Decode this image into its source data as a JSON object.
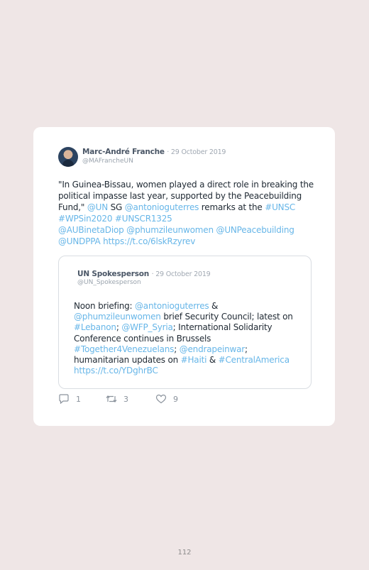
{
  "tweet": {
    "author_name": "Marc-André Franche",
    "date": "· 29 October 2019",
    "handle": "@MAFrancheUN",
    "t1": "\"In Guinea-Bissau, women played a direct role in breaking the political impasse last year, supported by the Peacebuilding Fund,\" ",
    "l_un": "@UN",
    "t2": " SG ",
    "l_ag": "@antonioguterres",
    "t3": " remarks at the ",
    "l_unsc": "#UNSC",
    "l_wps": "#WPSin2020",
    "l_unscr": "#UNSCR1325",
    "l_aub": "@AUBinetaDiop",
    "l_phum": "@phumzileunwomen",
    "l_unpb": "@UNPeacebuilding",
    "l_undppa": "@UNDPPA",
    "l_url": "https://t.co/6lskRzyrev"
  },
  "quoted": {
    "author_name": "UN Spokesperson",
    "date": "· 29 October 2019",
    "handle": "@UN_Spokesperson",
    "t1": "Noon briefing: ",
    "l_ag": "@antonioguterres",
    "t2": " & ",
    "l_phum": "@phumzileunwomen",
    "t3": " brief Security Council; latest on ",
    "l_leb": "#Lebanon",
    "t4": "; ",
    "l_wfp": "@WFP_Syria",
    "t5": "; International Solidarity Conference continues in Brussels ",
    "l_tog": "#Together4Venezuelans",
    "t6": "; ",
    "l_endr": "@endrapeinwar",
    "t7": "; humanitarian updates on ",
    "l_haiti": "#Haiti",
    "t8": " & ",
    "l_ca": "#CentralAmerica",
    "l_url": "https://t.co/YDghrBC"
  },
  "actions": {
    "replies": "1",
    "retweets": "3",
    "likes": "9"
  },
  "icons": {
    "reply": "reply-icon",
    "retweet": "retweet-icon",
    "like": "heart-icon"
  },
  "colors": {
    "link": "#67b6e8",
    "background": "#efe6e6"
  },
  "page_number": "112"
}
